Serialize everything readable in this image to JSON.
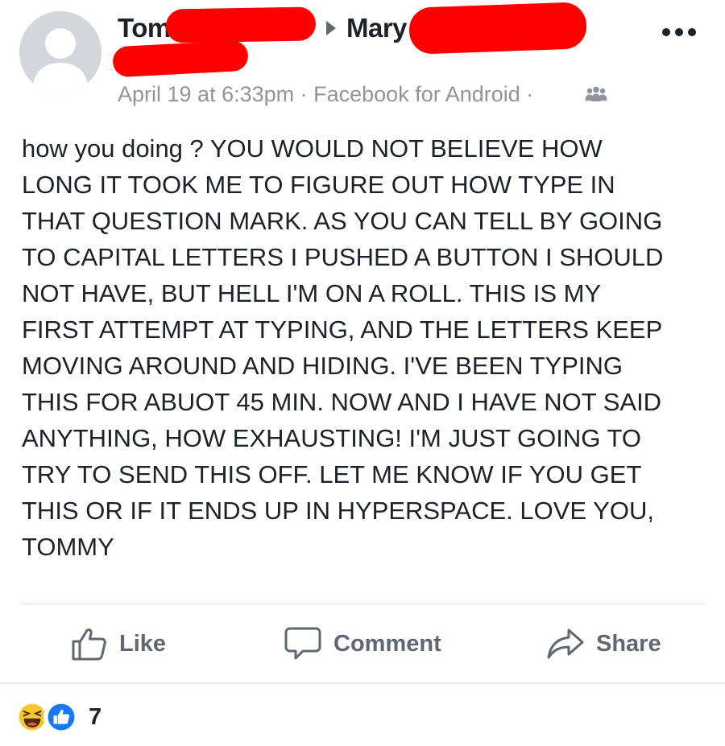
{
  "post": {
    "author": "Tom",
    "recipient": "Mary",
    "timestamp": "April 19 at 6:33pm",
    "meta_separator": " · ",
    "source": "Facebook for Android",
    "trailing_separator": " ·",
    "audience_icon": "friends-icon",
    "message_lines": [
      "how you doing ? YOU WOULD NOT BELIEVE HOW",
      "LONG IT TOOK ME TO FIGURE OUT HOW TYPE IN",
      "THAT QUESTION MARK. AS YOU CAN TELL BY GOING",
      "TO CAPITAL LETTERS I PUSHED A BUTTON I SHOULD",
      "NOT HAVE, BUT HELL I'M ON A ROLL. THIS IS MY",
      "FIRST ATTEMPT AT TYPING, AND THE LETTERS KEEP",
      "MOVING AROUND AND HIDING. I'VE BEEN TYPING",
      "THIS FOR ABUOT 45 MIN. NOW AND I HAVE NOT SAID",
      "ANYTHING, HOW EXHAUSTING! I'M JUST GOING TO",
      "TRY TO SEND THIS OFF. LET ME KNOW IF YOU GET",
      "THIS OR IF IT ENDS UP IN HYPERSPACE. LOVE YOU,",
      "TOMMY"
    ]
  },
  "actions": {
    "like_label": "Like",
    "comment_label": "Comment",
    "share_label": "Share"
  },
  "reactions": {
    "types": [
      "haha",
      "like"
    ],
    "count": "7"
  },
  "colors": {
    "redaction": "#ff0000",
    "secondary_text": "#90949c",
    "action_text": "#606770",
    "like_blue": "#1877f2",
    "haha_yellow": "#f7c52d"
  }
}
